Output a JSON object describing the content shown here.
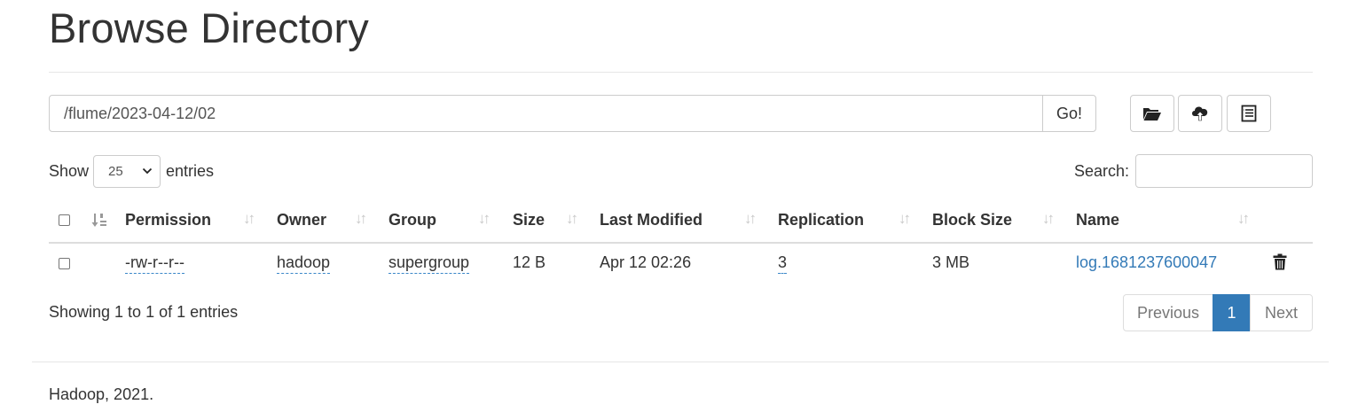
{
  "page": {
    "title": "Browse Directory"
  },
  "toolbar": {
    "path_value": "/flume/2023-04-12/02",
    "go_label": "Go!",
    "buttons": [
      "create-directory-icon",
      "upload-icon",
      "cut-paste-icon"
    ]
  },
  "controls": {
    "show_label": "Show",
    "page_length": "25",
    "entries_label": "entries",
    "search_label": "Search:",
    "search_value": ""
  },
  "table": {
    "columns": [
      "Permission",
      "Owner",
      "Group",
      "Size",
      "Last Modified",
      "Replication",
      "Block Size",
      "Name"
    ],
    "rows": [
      {
        "permission": "-rw-r--r--",
        "owner": "hadoop",
        "group": "supergroup",
        "size": "12 B",
        "last_modified": "Apr 12 02:26",
        "replication": "3",
        "block_size": "3 MB",
        "name": "log.1681237600047"
      }
    ]
  },
  "info": "Showing 1 to 1 of 1 entries",
  "pagination": {
    "previous": "Previous",
    "current": "1",
    "next": "Next"
  },
  "footer": "Hadoop, 2021.",
  "colors": {
    "link": "#337ab7",
    "active_page": "#337ab7",
    "border": "#cccccc"
  }
}
